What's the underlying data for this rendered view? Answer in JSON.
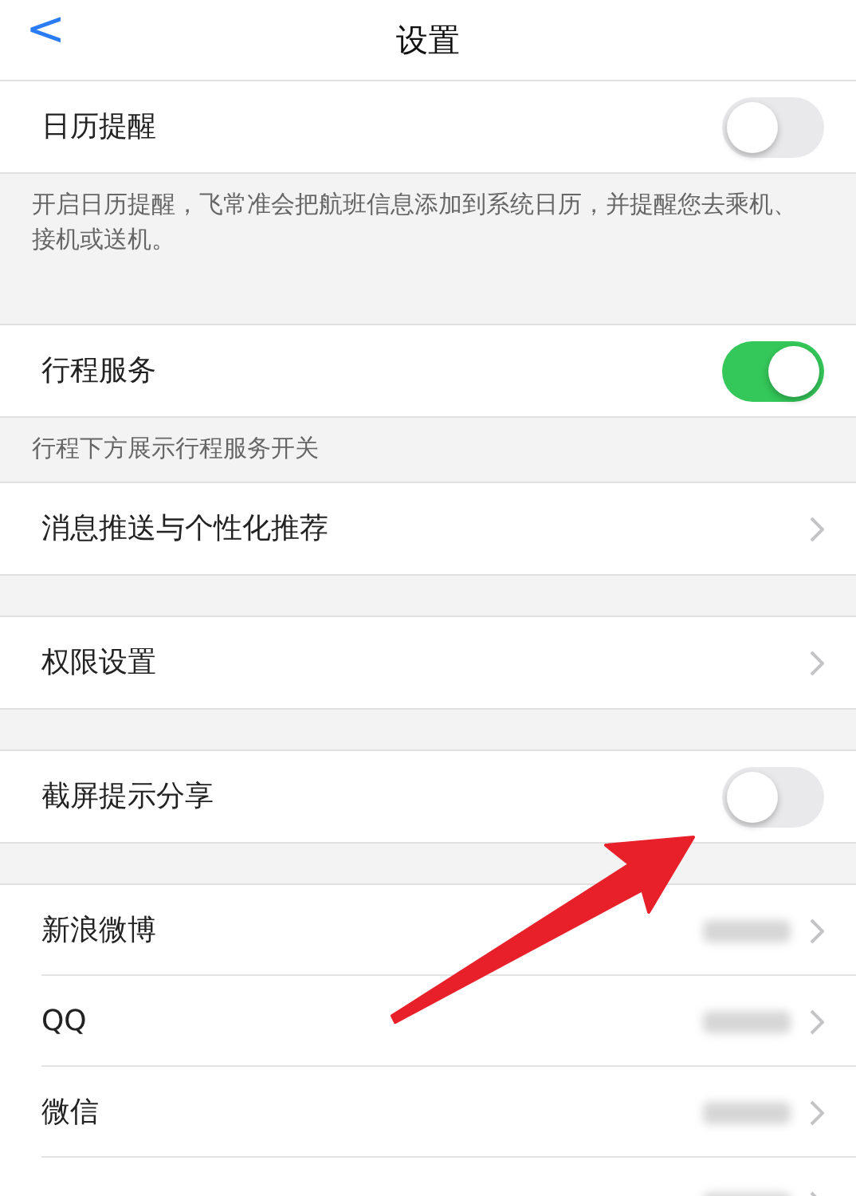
{
  "nav": {
    "back": "<",
    "title": "设置"
  },
  "sections": [
    {
      "rows": [
        {
          "kind": "toggle",
          "label": "日历提醒",
          "on": false
        }
      ],
      "note": "开启日历提醒，飞常准会把航班信息添加到系统日历，并提醒您去乘机、接机或送机。"
    },
    {
      "rows": [
        {
          "kind": "toggle",
          "label": "行程服务",
          "on": true
        }
      ],
      "note": "行程下方展示行程服务开关"
    },
    {
      "rows": [
        {
          "kind": "link",
          "label": "消息推送与个性化推荐"
        }
      ]
    },
    {
      "rows": [
        {
          "kind": "link",
          "label": "权限设置"
        }
      ]
    },
    {
      "rows": [
        {
          "kind": "toggle",
          "label": "截屏提示分享",
          "on": false
        }
      ]
    },
    {
      "rows": [
        {
          "kind": "account",
          "label": "新浪微博"
        },
        {
          "kind": "account",
          "label": "QQ"
        },
        {
          "kind": "account",
          "label": "微信"
        },
        {
          "kind": "account"
        }
      ]
    }
  ]
}
